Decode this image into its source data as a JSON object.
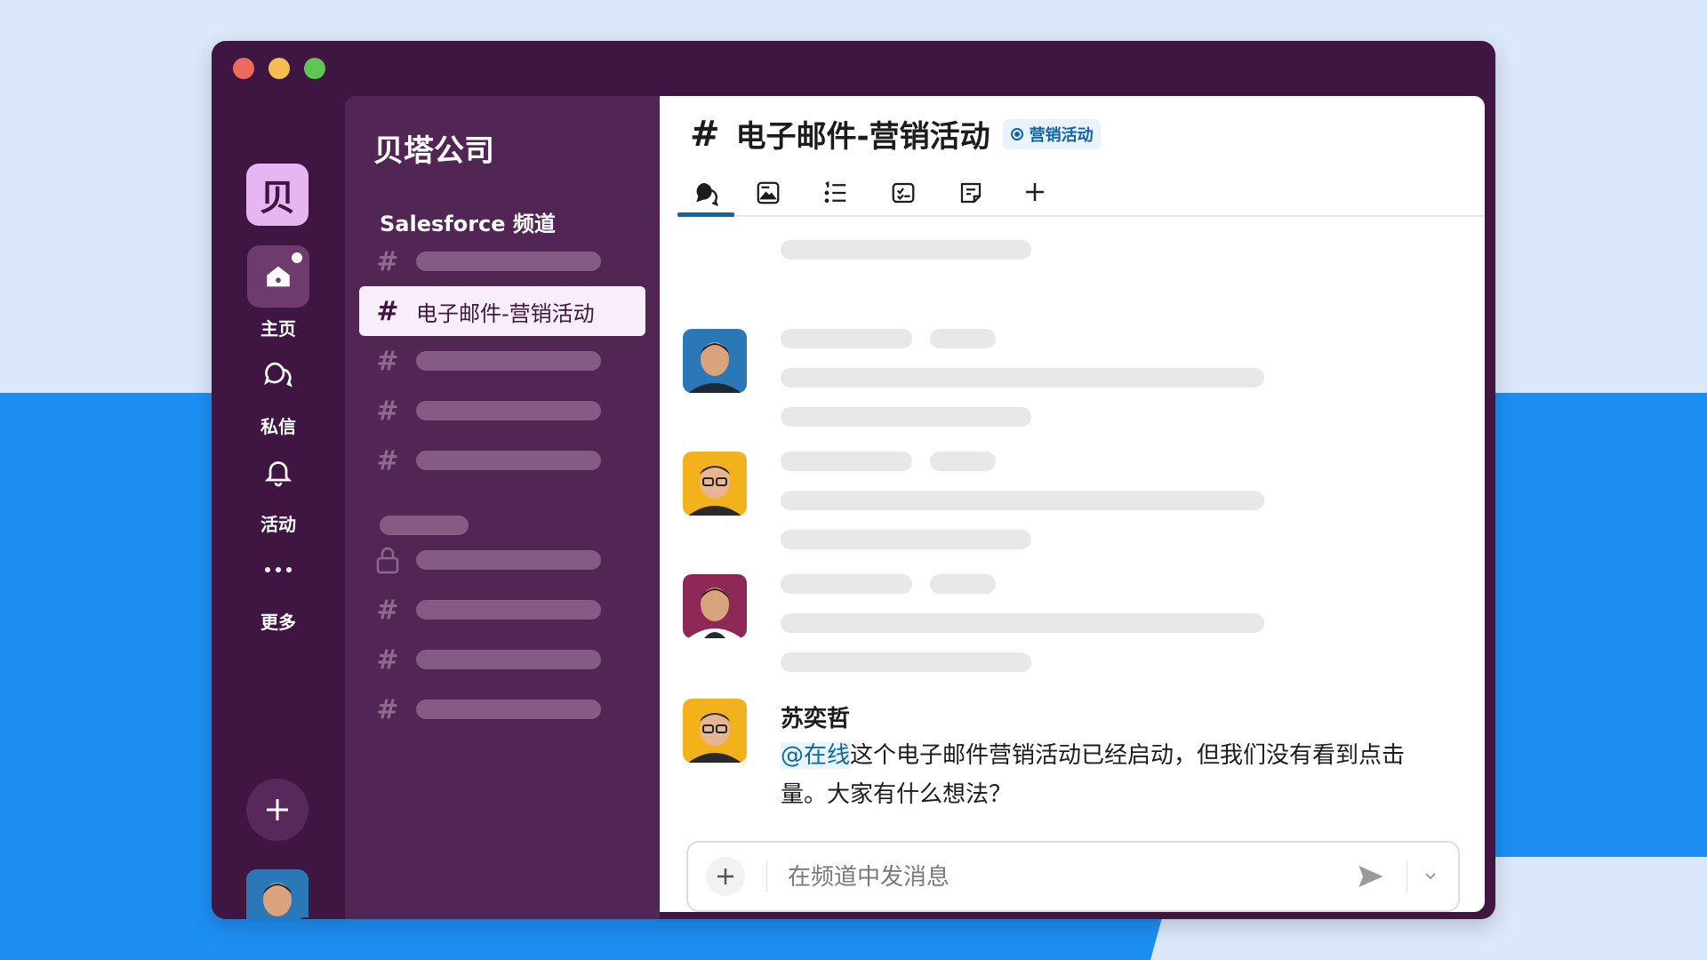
{
  "workspace": {
    "logo_char": "贝",
    "name": "贝塔公司"
  },
  "rail": {
    "items": [
      {
        "label": "主页",
        "icon": "home-icon"
      },
      {
        "label": "私信",
        "icon": "dm-icon"
      },
      {
        "label": "活动",
        "icon": "bell-icon"
      },
      {
        "label": "更多",
        "icon": "more-icon"
      }
    ]
  },
  "sidebar": {
    "section_title": "Salesforce 频道",
    "active_channel": "电子邮件-营销活动"
  },
  "channel": {
    "name": "电子邮件-营销活动",
    "tag": "营销活动"
  },
  "message": {
    "author": "苏奕哲",
    "mention": "@在线",
    "text": "这个电子邮件营销活动已经启动，但我们没有看到点击量。大家有什么想法？"
  },
  "composer": {
    "placeholder": "在频道中发消息"
  },
  "colors": {
    "window": "#3f1541",
    "sidebar": "#512654",
    "accent": "#1264a3",
    "logo": "#e7b6f2",
    "online": "#2bac76"
  }
}
